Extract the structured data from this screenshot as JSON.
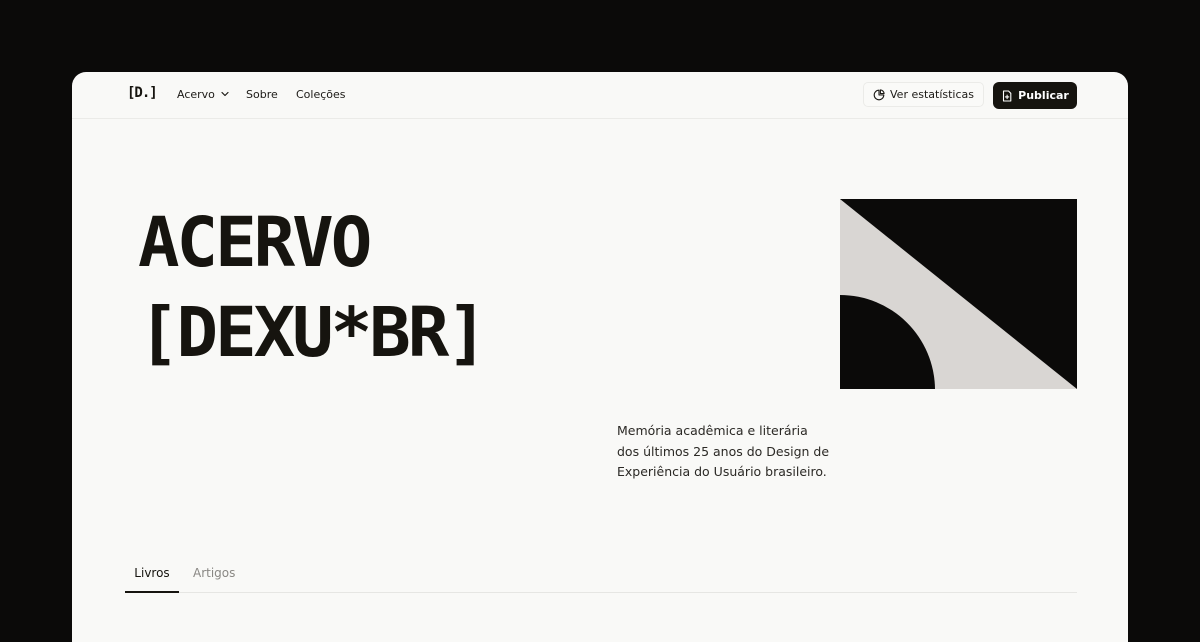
{
  "header": {
    "logo_text": "[D.]",
    "nav": [
      {
        "label": "Acervo",
        "has_dropdown": true
      },
      {
        "label": "Sobre"
      },
      {
        "label": "Coleções"
      }
    ],
    "stats_button": {
      "label": "Ver estatísticas",
      "icon": "pie-chart-icon"
    },
    "publish_button": {
      "label": "Publicar",
      "icon": "file-plus-icon"
    }
  },
  "hero": {
    "title_line1": "ACERVO",
    "title_line2": "[DEXU*BR]",
    "description": "Memória acadêmica e literária dos últimos 25 anos do Design de Experiência do Usuário brasileiro."
  },
  "tabs": [
    {
      "label": "Livros",
      "active": true
    },
    {
      "label": "Artigos",
      "active": false
    }
  ],
  "colors": {
    "background": "#0b0a09",
    "surface": "#f9f9f7",
    "ink": "#16140f",
    "art_light": "#d9d6d3",
    "muted": "#8a8884"
  }
}
